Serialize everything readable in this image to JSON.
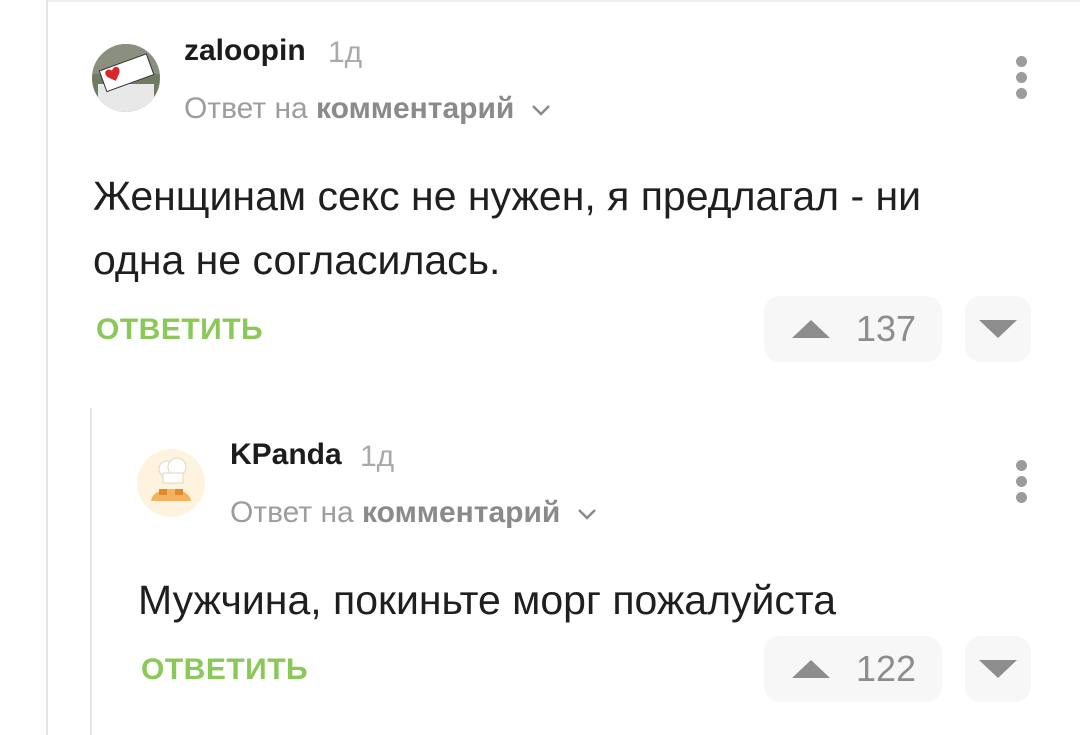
{
  "comments": [
    {
      "username": "zaloopin",
      "time": "1д",
      "reply_prefix": "Ответ на",
      "reply_target": "комментарий",
      "text": "Женщинам секс не нужен, я предлагал - ни одна не согласилась.",
      "reply_label": "ОТВЕТИТЬ",
      "score": "137",
      "avatar_icon": "heart-sign-avatar"
    },
    {
      "username": "KPanda",
      "time": "1д",
      "reply_prefix": "Ответ на",
      "reply_target": "комментарий",
      "text": "Мужчина, покиньте морг пожалуйста",
      "reply_label": "ОТВЕТИТЬ",
      "score": "122",
      "avatar_icon": "chef-avatar"
    }
  ],
  "colors": {
    "accent_green": "#8ac858",
    "muted_text": "#9d9d9d",
    "vote_bg": "#f7f7f7",
    "thread_line": "#e6e6e6"
  }
}
